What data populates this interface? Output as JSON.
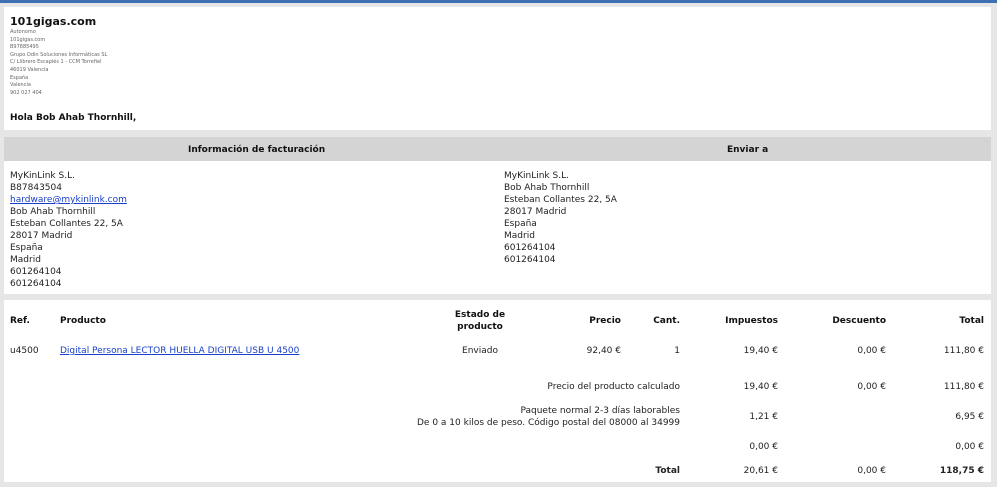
{
  "shop": {
    "name": "101gigas.com",
    "details": [
      "Autonomo",
      "101gigas.com",
      "B97885495",
      "Grupo Odin Soluciones Informáticas SL",
      "C/ Llibrero Escaplés 1 - CCM Torrefiel",
      "46019 Valencia",
      "España",
      "Valencia",
      "902 027 404"
    ],
    "greeting": "Hola Bob Ahab Thornhill,"
  },
  "billing": {
    "title": "Información de facturación",
    "lines_before_email": [
      "MyKinLink S.L.",
      "B87843504"
    ],
    "email": "hardware@mykinlink.com",
    "lines_after_email": [
      "Bob Ahab Thornhill",
      "Esteban Collantes 22, 5A",
      "28017 Madrid",
      "España",
      "Madrid",
      "601264104",
      "601264104"
    ]
  },
  "shipping": {
    "title": "Enviar a",
    "lines": [
      "MyKinLink S.L.",
      "Bob Ahab Thornhill",
      "Esteban Collantes 22, 5A",
      "28017 Madrid",
      "España",
      "Madrid",
      "601264104",
      "601264104"
    ]
  },
  "order": {
    "headers": {
      "ref": "Ref.",
      "product": "Producto",
      "state_line1": "Estado de",
      "state_line2": "producto",
      "price": "Precio",
      "qty": "Cant.",
      "tax": "Impuestos",
      "discount": "Descuento",
      "total": "Total"
    },
    "item": {
      "ref": "u4500",
      "product": "Digital Persona LECTOR HUELLA DIGITAL USB U 4500",
      "state": "Enviado",
      "price": "92,40 €",
      "qty": "1",
      "tax": "19,40 €",
      "discount": "0,00 €",
      "total": "111,80 €"
    },
    "calculated": {
      "label": "Precio del producto calculado",
      "tax": "19,40 €",
      "discount": "0,00 €",
      "total": "111,80 €"
    },
    "shipping_row": {
      "label_line1": "Paquete normal 2-3 días laborables",
      "label_line2": "De 0 a 10 kilos de peso. Código postal del 08000 al 34999",
      "tax": "1,21 €",
      "total": "6,95 €"
    },
    "extra_row": {
      "tax": "0,00 €",
      "total": "0,00 €"
    },
    "grand_total": {
      "label": "Total",
      "tax": "20,61 €",
      "discount": "0,00 €",
      "total": "118,75 €"
    }
  }
}
